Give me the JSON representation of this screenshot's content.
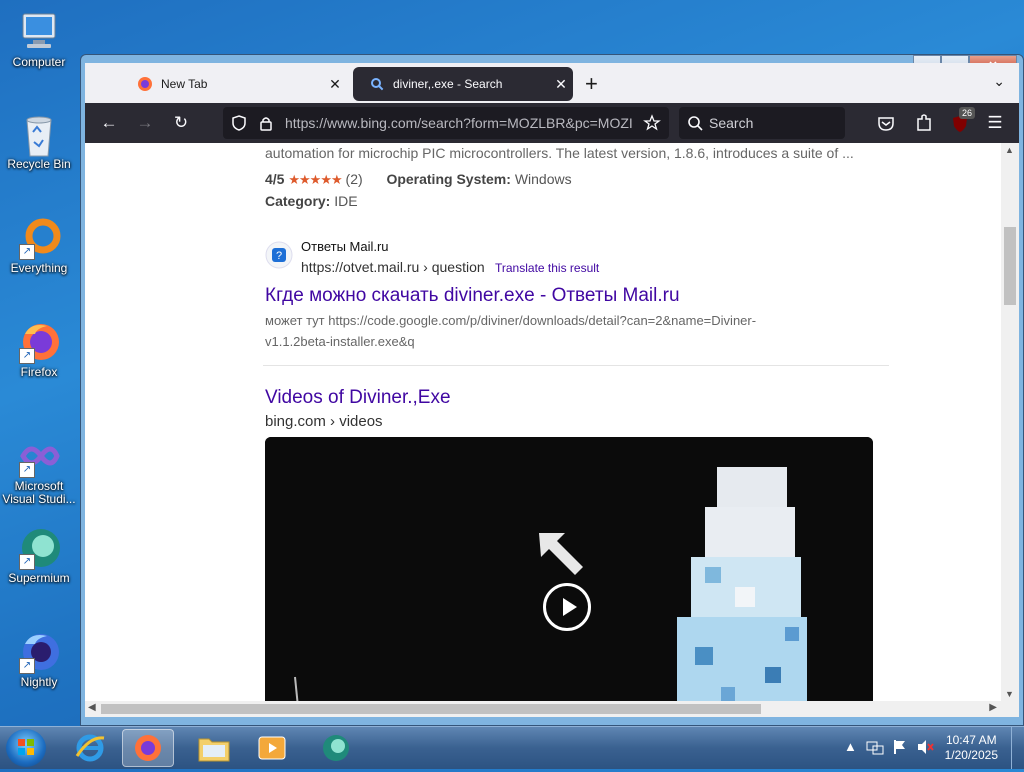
{
  "desktop": {
    "icons": [
      {
        "label": "Computer",
        "icon": "computer-icon"
      },
      {
        "label": "Recycle Bin",
        "icon": "recycle-bin-icon"
      },
      {
        "label": "Everything",
        "icon": "everything-icon"
      },
      {
        "label": "Firefox",
        "icon": "firefox-icon"
      },
      {
        "label": "Microsoft Visual Studi...",
        "icon": "visual-studio-icon"
      },
      {
        "label": "Supermium",
        "icon": "supermium-icon"
      },
      {
        "label": "Nightly",
        "icon": "nightly-icon"
      }
    ]
  },
  "browser": {
    "tabs": [
      {
        "title": "New Tab",
        "close": "✕"
      },
      {
        "title": "diviner,.exe - Search",
        "close": "✕"
      }
    ],
    "new_tab": "+",
    "url": "https://www.bing.com/search?form=MOZLBR&pc=MOZI",
    "search_placeholder": "Search",
    "extension_badge": "26"
  },
  "page": {
    "result1": {
      "snippet": "automation for microchip PIC microcontrollers. The latest version, 1.8.6, introduces a suite of ...",
      "rating": "4/5",
      "stars": "★★★★★",
      "rating_count": "(2)",
      "os_label": "Operating System:",
      "os_value": "Windows",
      "category_label": "Category:",
      "category_value": "IDE"
    },
    "result2": {
      "site_name": "Ответы Mail.ru",
      "url": "https://otvet.mail.ru › question",
      "translate": "Translate this result",
      "title": "Кгде можно скачать diviner.exe - Ответы Mail.ru",
      "snippet_line1": "может тут https://code.google.com/p/diviner/downloads/detail?can=2&name=Diviner-",
      "snippet_line2": "v1.1.2beta-installer.exe&q"
    },
    "videos": {
      "title": "Videos of Diviner.,Exe",
      "source": "bing.com › videos"
    }
  },
  "taskbar": {
    "time": "10:47 AM",
    "date": "1/20/2025"
  },
  "colors": {
    "link": "#4007a2",
    "star": "#de5a2c",
    "toolbar": "#2b2a33"
  }
}
